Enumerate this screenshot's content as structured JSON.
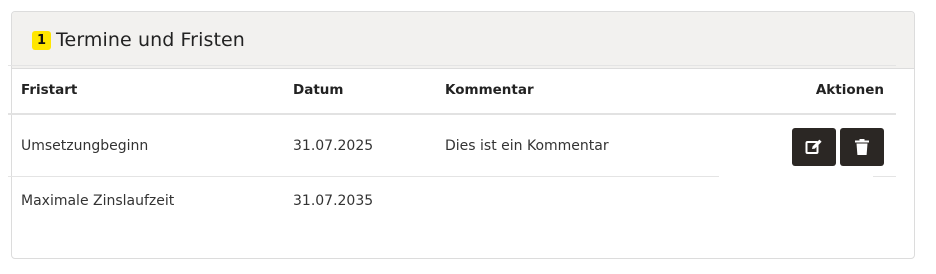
{
  "section": {
    "badge": "1",
    "title": "Termine und Fristen"
  },
  "table": {
    "headers": {
      "fristart": "Fristart",
      "datum": "Datum",
      "kommentar": "Kommentar",
      "aktionen": "Aktionen"
    },
    "rows": [
      {
        "fristart": "Umsetzungbeginn",
        "datum": "31.07.2025",
        "kommentar": "Dies ist ein Kommentar"
      },
      {
        "fristart": "Maximale Zinslaufzeit",
        "datum": "31.07.2035",
        "kommentar": ""
      }
    ]
  },
  "icons": {
    "edit": "edit-icon",
    "delete": "trash-icon"
  },
  "colors": {
    "badge": "#ffe600",
    "header_bg": "#f2f1ef",
    "button_bg": "#2b2724"
  }
}
